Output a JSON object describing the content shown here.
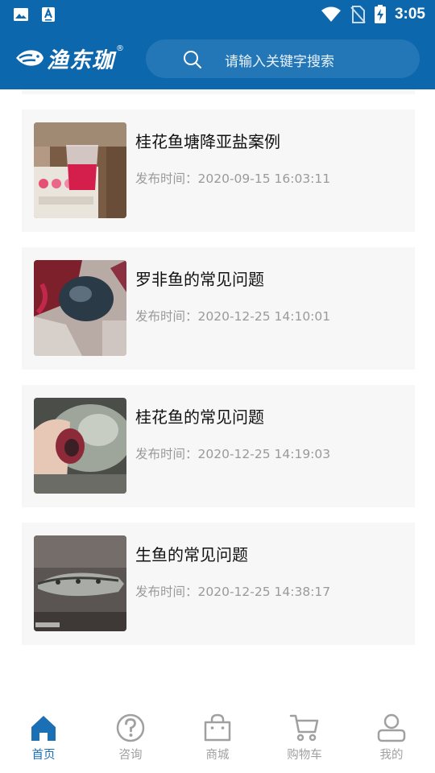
{
  "status_bar": {
    "time": "3:05"
  },
  "header": {
    "logo_text": "渔东珈",
    "logo_reg": "®",
    "search_placeholder": "请输入关键字搜索"
  },
  "articles": [
    {
      "title": "桂花鱼塘降亚盐案例",
      "time": "发布时间：2020-09-15 16:03:11"
    },
    {
      "title": "罗非鱼的常见问题",
      "time": "发布时间：2020-12-25 14:10:01"
    },
    {
      "title": "桂花鱼的常见问题",
      "time": "发布时间：2020-12-25 14:19:03"
    },
    {
      "title": "生鱼的常见问题",
      "time": "发布时间：2020-12-25 14:38:17"
    }
  ],
  "bottom_nav": [
    {
      "label": "首页",
      "icon": "home-icon",
      "active": true
    },
    {
      "label": "咨询",
      "icon": "help-icon",
      "active": false
    },
    {
      "label": "商城",
      "icon": "bag-icon",
      "active": false
    },
    {
      "label": "购物车",
      "icon": "cart-icon",
      "active": false
    },
    {
      "label": "我的",
      "icon": "person-icon",
      "active": false
    }
  ],
  "colors": {
    "primary": "#0c67ad",
    "active_nav": "#1a6fb5",
    "inactive_nav": "#a0a0a0",
    "card_bg": "#f7f7f7"
  }
}
